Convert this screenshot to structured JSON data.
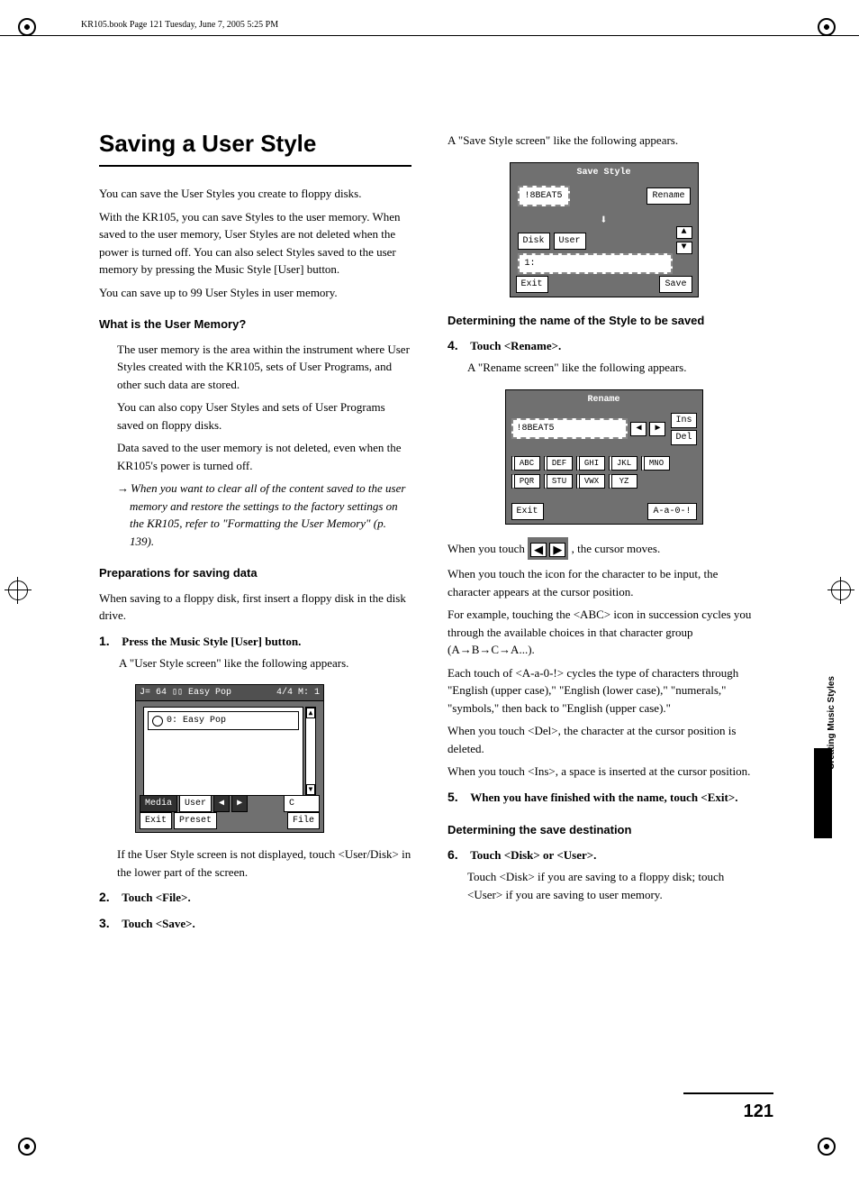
{
  "header": "KR105.book  Page 121  Tuesday, June 7, 2005  5:25 PM",
  "page_number": "121",
  "side_tab": "Creating Music Styles",
  "left": {
    "h1": "Saving a User Style",
    "p1": "You can save the User Styles you create to floppy disks.",
    "p2": "With the KR105, you can save Styles to the user memory. When saved to the user memory, User Styles are not deleted when the power is turned off. You can also select Styles saved to the user memory by pressing the Music Style [User] button.",
    "p3": "You can save up to 99 User Styles in user memory.",
    "h2_mem": "What is the User Memory?",
    "mem_p1": "The user memory is the area within the instrument where User Styles created with the KR105, sets of User Programs, and other such data are stored.",
    "mem_p2": "You can also copy User Styles and sets of User Programs saved on floppy disks.",
    "mem_p3": "Data saved to the user memory is not deleted, even when the KR105's power is turned off.",
    "crossref": "When you want to clear all of the content saved to the user memory and restore the settings to the factory settings on the KR105, refer to \"Formatting the User Memory\" (p. 139).",
    "h2_prep": "Preparations for saving data",
    "prep_p1": "When saving to a floppy disk, first insert a floppy disk in the disk drive.",
    "step1": "Press the Music Style [User] button.",
    "step1_body": "A \"User Style screen\" like the following appears.",
    "step1_after": "If the User Style screen is not displayed, touch <User/Disk> in the lower part of the screen.",
    "step2": "Touch <File>.",
    "step3": "Touch <Save>.",
    "user_style_screen": {
      "top_left": "J= 64 ▯▯ Easy Pop",
      "top_right": "4/4  M:  1",
      "item": "0: Easy Pop",
      "media": "Media",
      "user": "User",
      "c": "C",
      "exit": "Exit",
      "preset": "Preset",
      "file": "File"
    }
  },
  "right": {
    "intro": "A \"Save Style screen\" like the following appears.",
    "save_style_screen": {
      "title": "Save Style",
      "name_field": "!8BEAT5",
      "rename": "Rename",
      "disk": "Disk",
      "user": "User",
      "slot": "1:",
      "exit": "Exit",
      "save": "Save"
    },
    "h2_name": "Determining the name of the Style to be saved",
    "step4": "Touch <Rename>.",
    "step4_body": "A \"Rename screen\" like the following appears.",
    "rename_screen": {
      "title": "Rename",
      "name_field": "!8BEAT5",
      "ins": "Ins",
      "del": "Del",
      "keys_row1": [
        "ABC",
        "DEF",
        "GHI",
        "JKL",
        "MNO"
      ],
      "keys_row2": [
        "PQR",
        "STU",
        "VWX",
        "YZ",
        ""
      ],
      "exit": "Exit",
      "mode": "A-a-0-!"
    },
    "cursor_p1a": "When you touch ",
    "cursor_p1b": ", the cursor moves.",
    "p_input": "When you touch the icon for the character to be input, the character appears at the cursor position.",
    "p_example": "For example, touching the <ABC> icon in succession cycles you through the available choices in that character group (A→B→C→A...).",
    "p_mode": "Each touch of <A-a-0-!> cycles the type of characters through \"English (upper case),\" \"English (lower case),\" \"numerals,\" \"symbols,\" then back to \"English (upper case).\"",
    "p_del": "When you touch <Del>, the character at the cursor position is deleted.",
    "p_ins": "When you touch <Ins>, a space is inserted at the cursor position.",
    "step5": "When you have finished with the name, touch <Exit>.",
    "h2_dest": "Determining the save destination",
    "step6": "Touch <Disk> or <User>.",
    "step6_body": "Touch <Disk> if you are saving to a floppy disk; touch <User> if you are saving to user memory."
  }
}
